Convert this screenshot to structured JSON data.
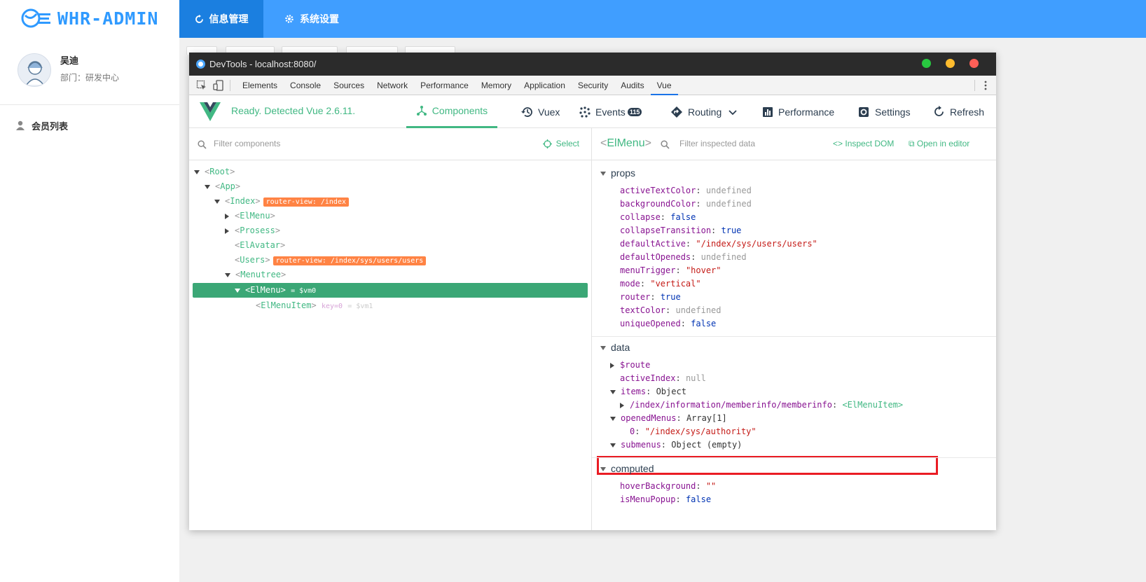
{
  "app": {
    "logo_text": "WHR-ADMIN",
    "user_name": "吴迪",
    "user_dept": "部门：研发中心",
    "side_menu_item": "会员列表",
    "top_tabs": [
      "信息管理",
      "系统设置"
    ]
  },
  "devtools": {
    "title": "DevTools - localhost:8080/",
    "window_buttons": {
      "green": "#28c840",
      "yellow": "#febc2e",
      "red": "#ff5f57"
    },
    "tabs": [
      "Elements",
      "Console",
      "Sources",
      "Network",
      "Performance",
      "Memory",
      "Application",
      "Security",
      "Audits",
      "Vue"
    ],
    "active_tab": "Vue"
  },
  "vue": {
    "status": "Ready. Detected Vue 2.6.11.",
    "nav": {
      "components": "Components",
      "vuex": "Vuex",
      "events": "Events",
      "events_count": "115",
      "routing": "Routing",
      "performance": "Performance",
      "settings": "Settings",
      "refresh": "Refresh"
    },
    "filter_components_placeholder": "Filter components",
    "select_label": "Select",
    "tree": [
      {
        "name": "Root"
      },
      {
        "name": "App"
      },
      {
        "name": "Index",
        "tag": "router-view: /index"
      },
      {
        "name": "ElMenu"
      },
      {
        "name": "Prosess"
      },
      {
        "name": "ElAvatar"
      },
      {
        "name": "Users",
        "tag": "router-view: /index/sys/users/users"
      },
      {
        "name": "Menutree"
      },
      {
        "name": "ElMenu",
        "suffix": "= $vm0"
      },
      {
        "name": "ElMenuItem",
        "key": "key=0",
        "suffix": "= $vm1"
      }
    ],
    "inspector": {
      "component_name": "ElMenu",
      "filter_placeholder": "Filter inspected data",
      "inspect_dom": "Inspect DOM",
      "open_in_editor": "Open in editor",
      "sections": {
        "props": "props",
        "data": "data",
        "computed": "computed"
      },
      "props": [
        {
          "key": "activeTextColor",
          "value": "undefined"
        },
        {
          "key": "backgroundColor",
          "value": "undefined"
        },
        {
          "key": "collapse",
          "value": "false"
        },
        {
          "key": "collapseTransition",
          "value": "true"
        },
        {
          "key": "defaultActive",
          "value": "\"/index/sys/users/users\""
        },
        {
          "key": "defaultOpeneds",
          "value": "undefined"
        },
        {
          "key": "menuTrigger",
          "value": "\"hover\""
        },
        {
          "key": "mode",
          "value": "\"vertical\""
        },
        {
          "key": "router",
          "value": "true"
        },
        {
          "key": "textColor",
          "value": "undefined"
        },
        {
          "key": "uniqueOpened",
          "value": "false"
        }
      ],
      "data": [
        {
          "key": "$route",
          "value": ""
        },
        {
          "key": "activeIndex",
          "value": "null"
        },
        {
          "key": "items",
          "value": "Object"
        },
        {
          "key": "/index/information/memberinfo/memberinfo",
          "value": "<ElMenuItem>"
        },
        {
          "key": "openedMenus",
          "value": "Array[1]"
        },
        {
          "key": "0",
          "value": "\"/index/sys/authority\""
        },
        {
          "key": "submenus",
          "value": "Object (empty)"
        }
      ],
      "computed": [
        {
          "key": "hoverBackground",
          "value": "\"\""
        },
        {
          "key": "isMenuPopup",
          "value": "false"
        }
      ]
    }
  },
  "colors": {
    "primary": "#409eff",
    "vue_green": "#41b883",
    "highlight": "#ea1c24"
  }
}
